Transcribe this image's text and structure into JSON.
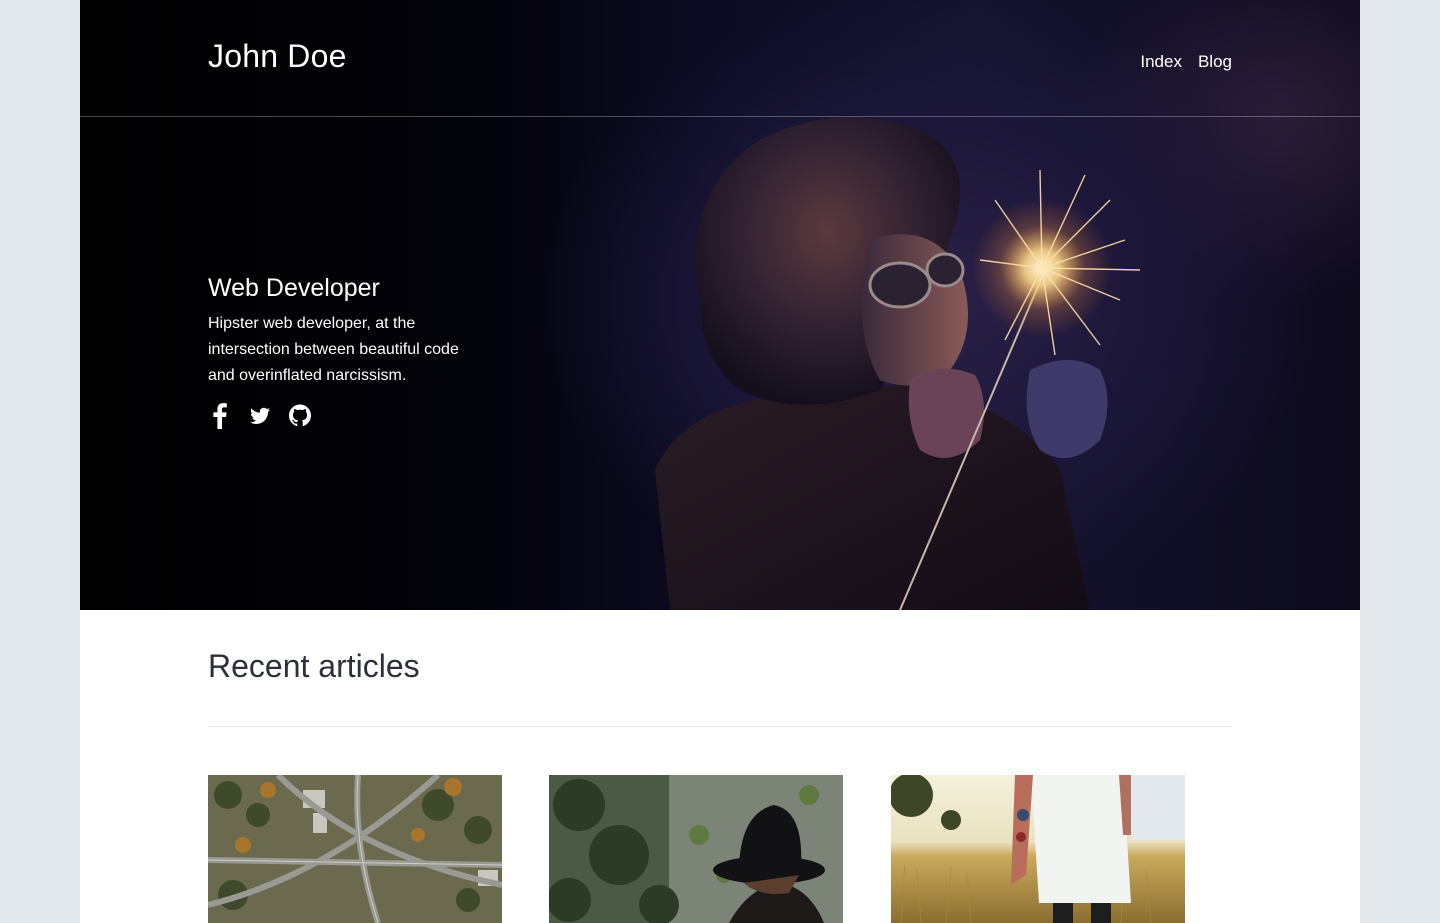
{
  "header": {
    "site_title": "John Doe",
    "nav": [
      {
        "label": "Index"
      },
      {
        "label": "Blog"
      }
    ]
  },
  "hero": {
    "heading": "Web Developer",
    "description": "Hipster web developer, at the intersection between beautiful code and overinflated narcissism.",
    "social": [
      {
        "icon": "facebook-icon"
      },
      {
        "icon": "twitter-icon"
      },
      {
        "icon": "github-icon"
      }
    ]
  },
  "articles": {
    "title": "Recent articles",
    "items": [
      {
        "image": "highway-aerial-photo"
      },
      {
        "image": "person-in-black-hat-photo"
      },
      {
        "image": "tattooed-person-in-field-photo"
      }
    ]
  },
  "colors": {
    "background": "#e3e8ec",
    "hero_dark": "#000000",
    "text_light": "#ffffff",
    "text_dark": "#2c3038"
  }
}
